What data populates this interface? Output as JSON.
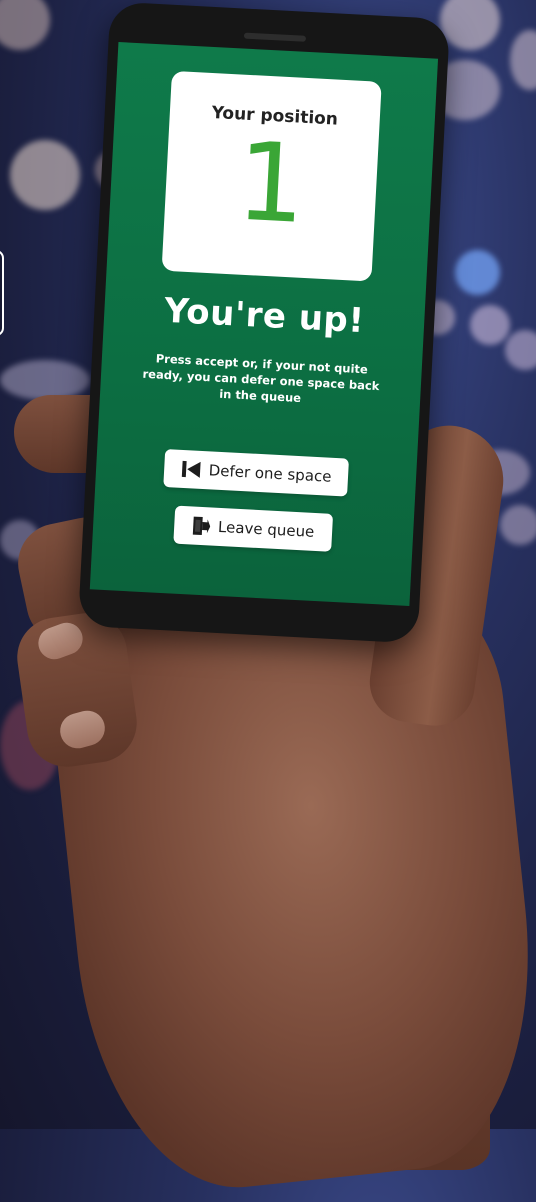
{
  "queue": {
    "position_label": "Your position",
    "position_number": "1",
    "headline": "You're up!",
    "message": "Press accept or, if your not quite ready, you can defer one space back in the queue"
  },
  "actions": {
    "defer_label": "Defer one space",
    "defer_icon": "skip-back-icon",
    "leave_label": "Leave queue",
    "leave_icon": "exit-door-icon"
  },
  "colors": {
    "screen_green": "#0c6e42",
    "number_green": "#3aa636",
    "card_white": "#ffffff"
  }
}
